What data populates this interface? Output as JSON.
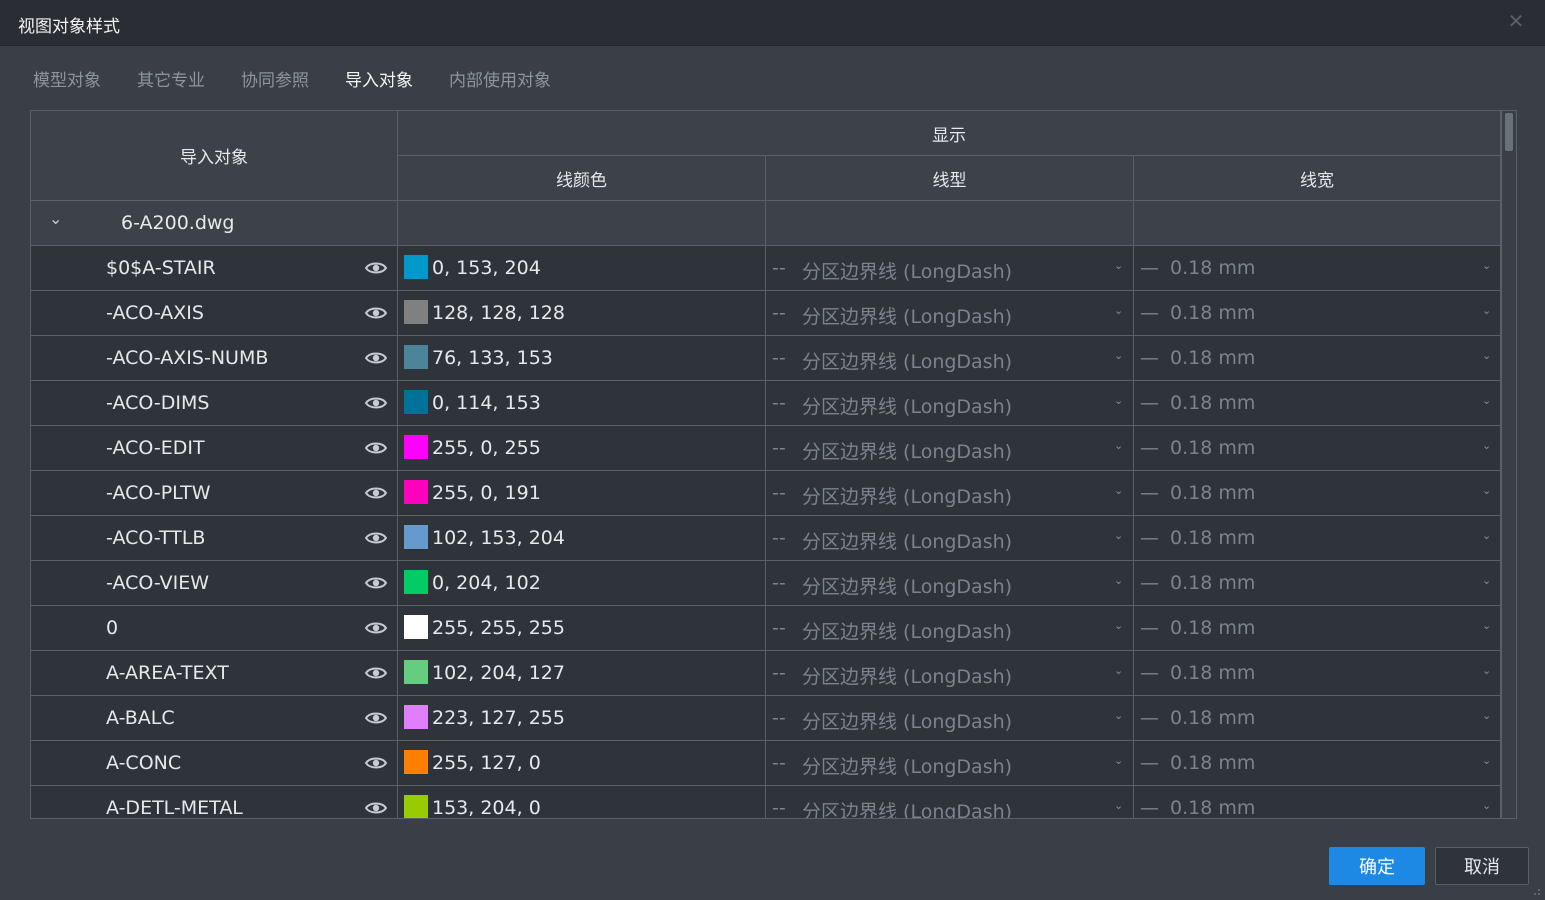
{
  "window": {
    "title": "视图对象样式"
  },
  "tabs": [
    {
      "label": "模型对象",
      "active": false
    },
    {
      "label": "其它专业",
      "active": false
    },
    {
      "label": "协同参照",
      "active": false
    },
    {
      "label": "导入对象",
      "active": true
    },
    {
      "label": "内部使用对象",
      "active": false
    }
  ],
  "table": {
    "header_object": "导入对象",
    "header_display": "显示",
    "header_color": "线颜色",
    "header_linetype": "线型",
    "header_lineweight": "线宽",
    "group_name": "6-A200.dwg",
    "rows": [
      {
        "name": "$0$A-STAIR",
        "rgb": "0, 153, 204",
        "color": "#0099cc",
        "linetype": "分区边界线 (LongDash)",
        "lineweight": "0.18 mm"
      },
      {
        "name": "-ACO-AXIS",
        "rgb": "128, 128, 128",
        "color": "#808080",
        "linetype": "分区边界线 (LongDash)",
        "lineweight": "0.18 mm"
      },
      {
        "name": "-ACO-AXIS-NUMB",
        "rgb": "76, 133, 153",
        "color": "#4c8599",
        "linetype": "分区边界线 (LongDash)",
        "lineweight": "0.18 mm"
      },
      {
        "name": "-ACO-DIMS",
        "rgb": "0, 114, 153",
        "color": "#007299",
        "linetype": "分区边界线 (LongDash)",
        "lineweight": "0.18 mm"
      },
      {
        "name": "-ACO-EDIT",
        "rgb": "255, 0, 255",
        "color": "#ff00ff",
        "linetype": "分区边界线 (LongDash)",
        "lineweight": "0.18 mm"
      },
      {
        "name": "-ACO-PLTW",
        "rgb": "255, 0, 191",
        "color": "#ff00bf",
        "linetype": "分区边界线 (LongDash)",
        "lineweight": "0.18 mm"
      },
      {
        "name": "-ACO-TTLB",
        "rgb": "102, 153, 204",
        "color": "#6699cc",
        "linetype": "分区边界线 (LongDash)",
        "lineweight": "0.18 mm"
      },
      {
        "name": "-ACO-VIEW",
        "rgb": "0, 204, 102",
        "color": "#00cc66",
        "linetype": "分区边界线 (LongDash)",
        "lineweight": "0.18 mm"
      },
      {
        "name": "0",
        "rgb": "255, 255, 255",
        "color": "#ffffff",
        "linetype": "分区边界线 (LongDash)",
        "lineweight": "0.18 mm"
      },
      {
        "name": "A-AREA-TEXT",
        "rgb": "102, 204, 127",
        "color": "#66cc7f",
        "linetype": "分区边界线 (LongDash)",
        "lineweight": "0.18 mm"
      },
      {
        "name": "A-BALC",
        "rgb": "223, 127, 255",
        "color": "#df7fff",
        "linetype": "分区边界线 (LongDash)",
        "lineweight": "0.18 mm"
      },
      {
        "name": "A-CONC",
        "rgb": "255, 127, 0",
        "color": "#ff7f00",
        "linetype": "分区边界线 (LongDash)",
        "lineweight": "0.18 mm"
      },
      {
        "name": "A-DETL-METAL",
        "rgb": "153, 204, 0",
        "color": "#99cc00",
        "linetype": "分区边界线 (LongDash)",
        "lineweight": "0.18 mm"
      }
    ]
  },
  "buttons": {
    "ok": "确定",
    "cancel": "取消"
  },
  "icons": {
    "close": "close-icon",
    "eye": "eye-icon",
    "chevron": "chevron-down-icon",
    "dropdown": "dropdown-arrow-icon"
  },
  "colors": {
    "accent": "#1e88e5",
    "background": "#3a3f47",
    "titlebar": "#2a2e34",
    "row_bg": "#2f343b"
  }
}
